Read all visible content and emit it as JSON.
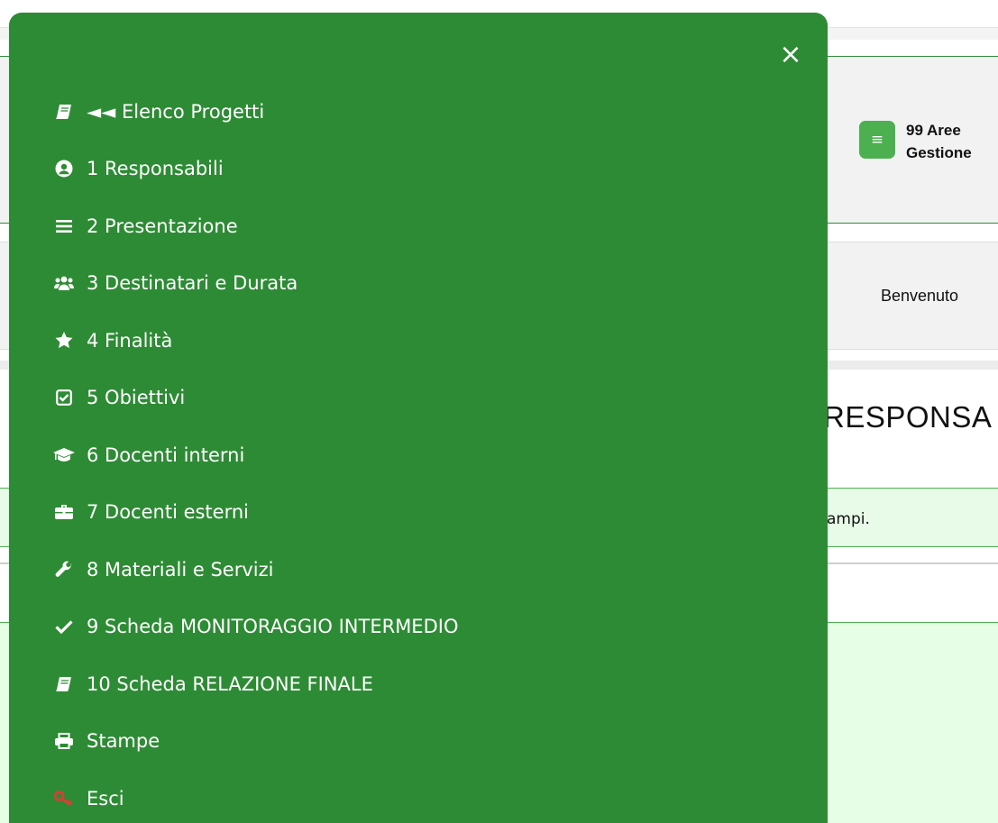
{
  "drawer": {
    "close_icon_glyph": "×",
    "items": [
      {
        "label": "◄◄ Elenco Progetti",
        "icon": "book-icon"
      },
      {
        "label": "1 Responsabili",
        "icon": "user-circle-icon"
      },
      {
        "label": "2 Presentazione",
        "icon": "bars-icon"
      },
      {
        "label": "3 Destinatari e Durata",
        "icon": "users-icon"
      },
      {
        "label": "4 Finalità",
        "icon": "star-icon"
      },
      {
        "label": "5 Obiettivi",
        "icon": "check-square-icon"
      },
      {
        "label": "6 Docenti interni",
        "icon": "graduation-cap-icon"
      },
      {
        "label": "7 Docenti esterni",
        "icon": "briefcase-icon"
      },
      {
        "label": "8 Materiali e Servizi",
        "icon": "wrench-icon"
      },
      {
        "label": "9 Scheda MONITORAGGIO INTERMEDIO",
        "icon": "check-icon"
      },
      {
        "label": "10 Scheda RELAZIONE FINALE",
        "icon": "book-icon"
      },
      {
        "label": "Stampe",
        "icon": "print-icon"
      },
      {
        "label": "Esci",
        "icon": "key-icon"
      }
    ]
  },
  "background": {
    "menu_button_glyph": "≡",
    "title_line1": "99 Aree",
    "title_line2": "Gestione",
    "welcome": "Benvenuto",
    "section_title": "RESPONSA",
    "alert_text": "ampi."
  },
  "colors": {
    "drawer_bg": "#2e8b35",
    "accent_green": "#4caf50",
    "exit_icon": "#e53935",
    "alert_bg": "#e8fbe8"
  }
}
